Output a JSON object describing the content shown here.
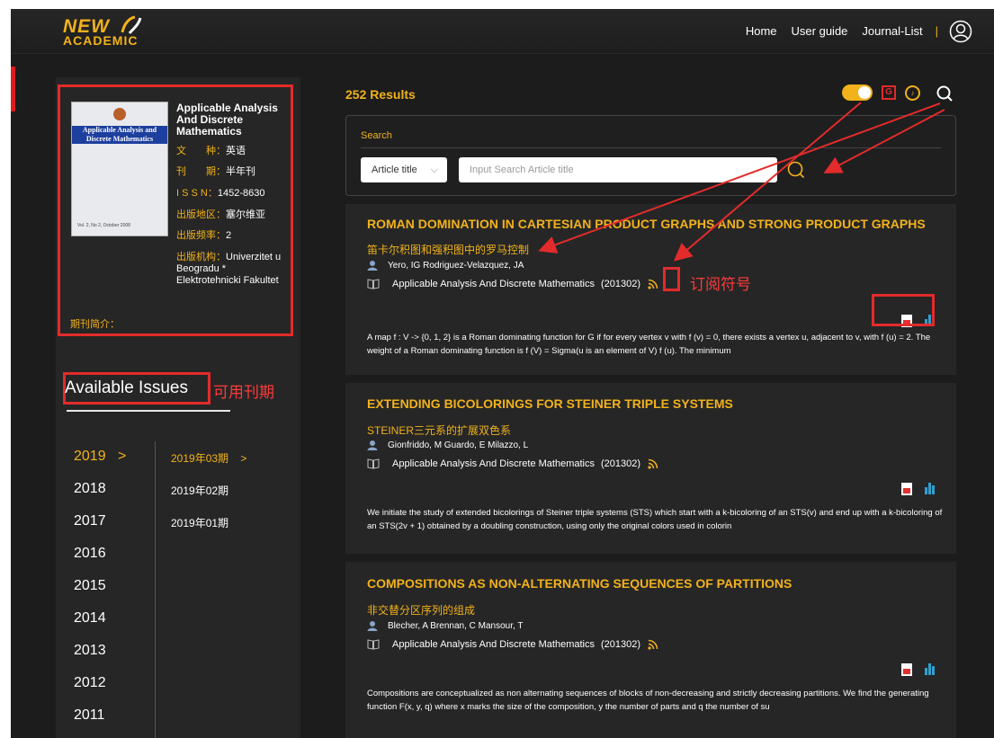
{
  "brand": {
    "line1": "NEW",
    "line2": "ACADEMIC"
  },
  "nav": {
    "home": "Home",
    "guide": "User guide",
    "journals": "Journal-List",
    "sep": "|"
  },
  "journal": {
    "title": "Applicable Analysis And Discrete Mathematics",
    "cover_band": "Applicable Analysis and Discrete Mathematics",
    "cover_footer": "Vol. 2, No 2, October 2008",
    "info": [
      {
        "k": "文　　种：",
        "v": "英语"
      },
      {
        "k": "刊　　期：",
        "v": "半年刊"
      },
      {
        "k": "I S S N：",
        "v": "1452-8630"
      },
      {
        "k": "出版地区：",
        "v": "塞尔维亚"
      },
      {
        "k": "出版频率：",
        "v": "2"
      },
      {
        "k": "出版机构：",
        "v": "Univerzitet u Beogradu * Elektrotehnicki Fakultet"
      }
    ],
    "intro_label": "期刊简介："
  },
  "issues_panel": {
    "title": "Available Issues",
    "annotation": "可用刊期",
    "years": [
      "2019",
      "2018",
      "2017",
      "2016",
      "2015",
      "2014",
      "2013",
      "2012",
      "2011"
    ],
    "active_year": "2019",
    "issues": [
      "2019年03期",
      "2019年02期",
      "2019年01期"
    ],
    "active_issue": "2019年03期",
    "chevron": ">"
  },
  "results": {
    "count": "252 Results"
  },
  "search": {
    "label": "Search",
    "field_option": "Article title",
    "placeholder": "Input Search Article title",
    "value": ""
  },
  "articles": [
    {
      "title": "ROMAN DOMINATION IN CARTESIAN PRODUCT GRAPHS AND STRONG PRODUCT GRAPHS",
      "title_cn": "笛卡尔积图和强积图中的罗马控制",
      "authors": "Yero, IG  Rodriguez-Velazquez, JA",
      "journal": "Applicable Analysis And Discrete Mathematics",
      "issue": "(201302)",
      "abstract": "A map f : V -> {0, 1, 2} is a Roman dominating function for G if for every vertex v with f (v) = 0, there exists a vertex u, adjacent to v, with f (u) = 2. The weight of a Roman dominating function is f (V) = Sigma(u is an element of V) f (u). The minimum"
    },
    {
      "title": "EXTENDING BICOLORINGS FOR STEINER TRIPLE SYSTEMS",
      "title_cn": "STEINER三元系的扩展双色系",
      "authors": "Gionfriddo, M  Guardo, E  Milazzo, L",
      "journal": "Applicable Analysis And Discrete Mathematics",
      "issue": "(201302)",
      "abstract": "We initiate the study of extended bicolorings of Steiner triple systems (STS) which start with a k-bicoloring of an STS(v) and end up with a k-bicoloring of an STS(2v + 1) obtained by a doubling construction, using only the original colors used in colorin"
    },
    {
      "title": "COMPOSITIONS AS NON-ALTERNATING SEQUENCES OF PARTITIONS",
      "title_cn": "非交替分区序列的组成",
      "authors": "Blecher, A  Brennan, C  Mansour, T",
      "journal": "Applicable Analysis And Discrete Mathematics",
      "issue": "(201302)",
      "abstract": "Compositions are conceptualized as non alternating sequences of blocks of non-decreasing and strictly decreasing partitions. We find the generating function F(x, y, q) where x marks the size of the composition, y the number of parts and q the number of su"
    }
  ],
  "annotations": {
    "subscribe": "订阅符号"
  },
  "colors": {
    "accent": "#f2b21b",
    "background": "#1c1c1c",
    "card": "#262626",
    "annotation_red": "#e32b2b"
  },
  "icons": [
    "avatar-icon",
    "toggle-switch",
    "google-scholar-icon",
    "music-icon",
    "search-icon",
    "author-icon",
    "book-icon",
    "rss-icon",
    "pdf-icon",
    "bar-chart-icon"
  ]
}
